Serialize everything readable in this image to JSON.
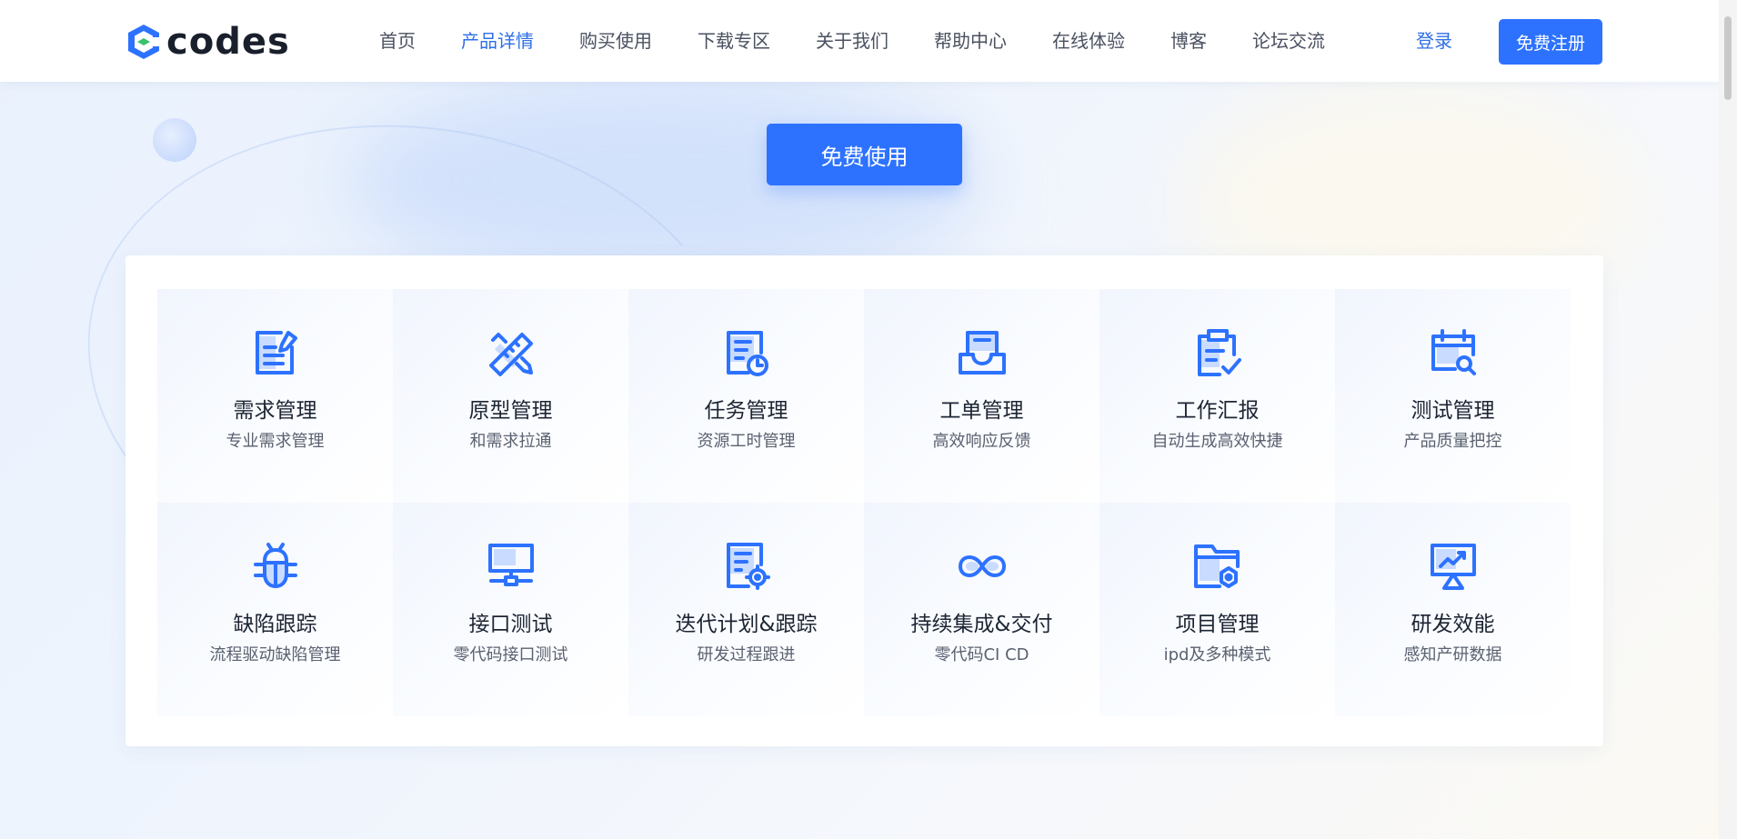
{
  "brand": {
    "name": "codes",
    "accent": "#2d72ff",
    "logo_green": "#37c26b"
  },
  "nav": {
    "items": [
      {
        "label": "首页",
        "active": false
      },
      {
        "label": "产品详情",
        "active": true
      },
      {
        "label": "购买使用",
        "active": false
      },
      {
        "label": "下载专区",
        "active": false
      },
      {
        "label": "关于我们",
        "active": false
      },
      {
        "label": "帮助中心",
        "active": false
      },
      {
        "label": "在线体验",
        "active": false
      },
      {
        "label": "博客",
        "active": false
      },
      {
        "label": "论坛交流",
        "active": false
      }
    ],
    "login": "登录",
    "register": "免费注册"
  },
  "hero": {
    "cta": "免费使用"
  },
  "features": [
    {
      "title": "需求管理",
      "subtitle": "专业需求管理",
      "icon": "requirement-doc-icon"
    },
    {
      "title": "原型管理",
      "subtitle": "和需求拉通",
      "icon": "ruler-pencil-icon"
    },
    {
      "title": "任务管理",
      "subtitle": "资源工时管理",
      "icon": "task-clock-icon"
    },
    {
      "title": "工单管理",
      "subtitle": "高效响应反馈",
      "icon": "inbox-tray-icon"
    },
    {
      "title": "工作汇报",
      "subtitle": "自动生成高效快捷",
      "icon": "clipboard-check-icon"
    },
    {
      "title": "测试管理",
      "subtitle": "产品质量把控",
      "icon": "calendar-search-icon"
    },
    {
      "title": "缺陷跟踪",
      "subtitle": "流程驱动缺陷管理",
      "icon": "bug-icon"
    },
    {
      "title": "接口测试",
      "subtitle": "零代码接口测试",
      "icon": "monitor-network-icon"
    },
    {
      "title": "迭代计划&跟踪",
      "subtitle": "研发过程跟进",
      "icon": "doc-target-icon"
    },
    {
      "title": "持续集成&交付",
      "subtitle": "零代码CI CD",
      "icon": "infinity-loop-icon"
    },
    {
      "title": "项目管理",
      "subtitle": "ipd及多种模式",
      "icon": "folder-hex-icon"
    },
    {
      "title": "研发效能",
      "subtitle": "感知产研数据",
      "icon": "presentation-chart-icon"
    }
  ]
}
